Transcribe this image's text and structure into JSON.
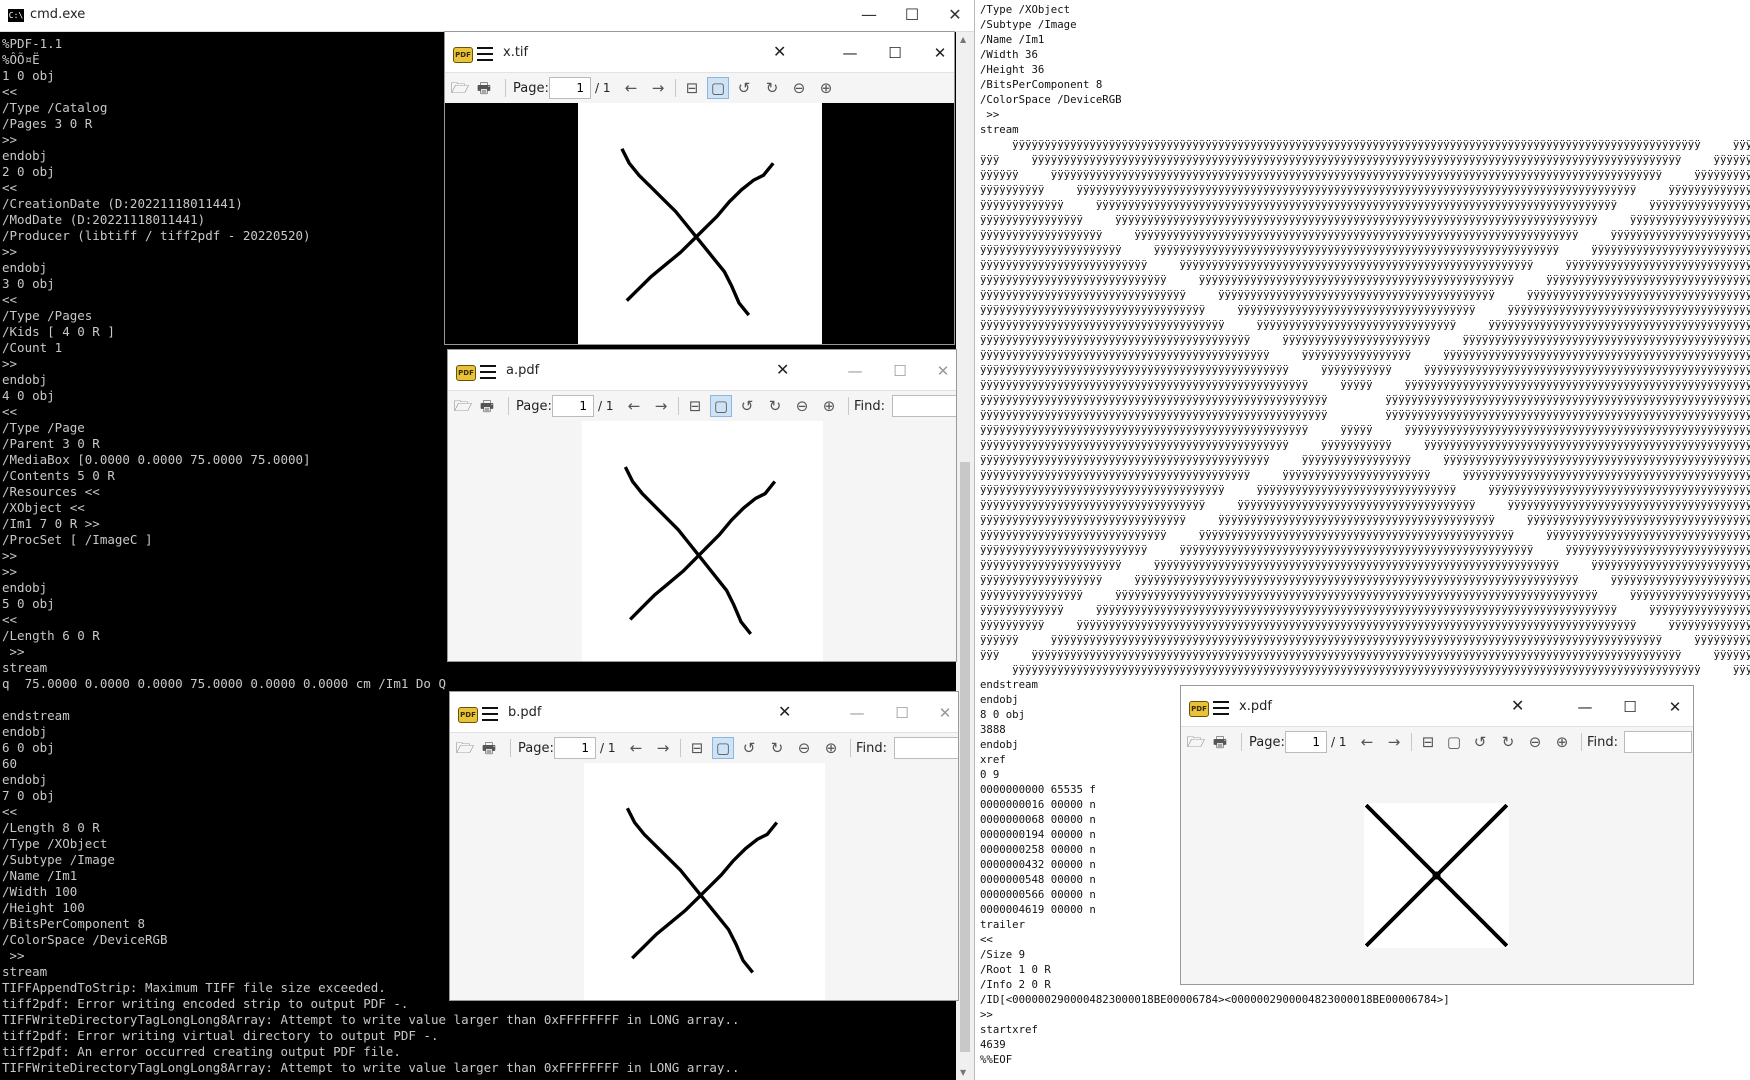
{
  "cmd": {
    "title": "cmd.exe",
    "icon": "C:\\",
    "minimize": "—",
    "maximize": "☐",
    "close": "✕",
    "lines": [
      "%PDF-1.1",
      "%ÔÕ¤Ë",
      "1 0 obj",
      "<<",
      "/Type /Catalog",
      "/Pages 3 0 R",
      ">>",
      "endobj",
      "2 0 obj",
      "<<",
      "/CreationDate (D:20221118011441)",
      "/ModDate (D:20221118011441)",
      "/Producer (libtiff / tiff2pdf - 20220520)",
      ">>",
      "endobj",
      "3 0 obj",
      "<<",
      "/Type /Pages",
      "/Kids [ 4 0 R ]",
      "/Count 1",
      ">>",
      "endobj",
      "4 0 obj",
      "<<",
      "/Type /Page",
      "/Parent 3 0 R",
      "/MediaBox [0.0000 0.0000 75.0000 75.0000]",
      "/Contents 5 0 R",
      "/Resources <<",
      "/XObject <<",
      "/Im1 7 0 R >>",
      "/ProcSet [ /ImageC ]",
      ">>",
      ">>",
      "endobj",
      "5 0 obj",
      "<<",
      "/Length 6 0 R",
      " >>",
      "stream",
      "q  75.0000 0.0000 0.0000 75.0000 0.0000 0.0000 cm /Im1 Do Q",
      "",
      "endstream",
      "endobj",
      "6 0 obj",
      "60",
      "endobj",
      "7 0 obj",
      "<<",
      "/Length 8 0 R",
      "/Type /XObject",
      "/Subtype /Image",
      "/Name /Im1",
      "/Width 100",
      "/Height 100",
      "/BitsPerComponent 8",
      "/ColorSpace /DeviceRGB",
      " >>",
      "stream",
      "TIFFAppendToStrip: Maximum TIFF file size exceeded.",
      "tiff2pdf: Error writing encoded strip to output PDF -.",
      "TIFFWriteDirectoryTagLongLong8Array: Attempt to write value larger than 0xFFFFFFFF in LONG array..",
      "tiff2pdf: Error writing virtual directory to output PDF -.",
      "tiff2pdf: An error occurred creating output PDF file.",
      "TIFFWriteDirectoryTagLongLong8Array: Attempt to write value larger than 0xFFFFFFFF in LONG array.."
    ]
  },
  "viewer_common": {
    "page_label": "Page:",
    "page_value": "1",
    "page_total": "/ 1",
    "find_label": "Find:",
    "logo": "PDF",
    "close": "✕",
    "minimize": "—",
    "maximize": "☐",
    "icons": {
      "open": "🗁",
      "print": "🖶",
      "prev": "←",
      "next": "→",
      "fit_width": "⊟",
      "fit_page": "▢",
      "rotate_left": "↺",
      "rotate_right": "↻",
      "zoom_out": "⊖",
      "zoom_in": "⊕"
    }
  },
  "viewers": {
    "xtif": {
      "title": "x.tif"
    },
    "apdf": {
      "title": "a.pdf"
    },
    "bpdf": {
      "title": "b.pdf"
    },
    "xpdf": {
      "title": "x.pdf"
    }
  },
  "editor": {
    "header_lines": [
      "/Type /XObject",
      "/Subtype /Image",
      "/Name /Im1",
      "/Width 36",
      "/Height 36",
      "/BitsPerComponent 8",
      "/ColorSpace /DeviceRGB",
      " >>",
      "stream"
    ],
    "pattern_char": "ÿ",
    "footer_lines": [
      "endstream",
      "endobj",
      "8 0 obj",
      "3888",
      "endobj",
      "xref",
      "0 9",
      "0000000000 65535 f",
      "0000000016 00000 n",
      "0000000068 00000 n",
      "0000000194 00000 n",
      "0000000258 00000 n",
      "0000000432 00000 n",
      "0000000548 00000 n",
      "0000000566 00000 n",
      "0000004619 00000 n",
      "trailer",
      "<<",
      "/Size 9",
      "/Root 1 0 R",
      "/Info 2 0 R",
      "/ID[<0000002900004823000018BE00006784><0000002900004823000018BE00006784>]",
      ">>",
      "startxref",
      "4639",
      "%%EOF"
    ]
  }
}
